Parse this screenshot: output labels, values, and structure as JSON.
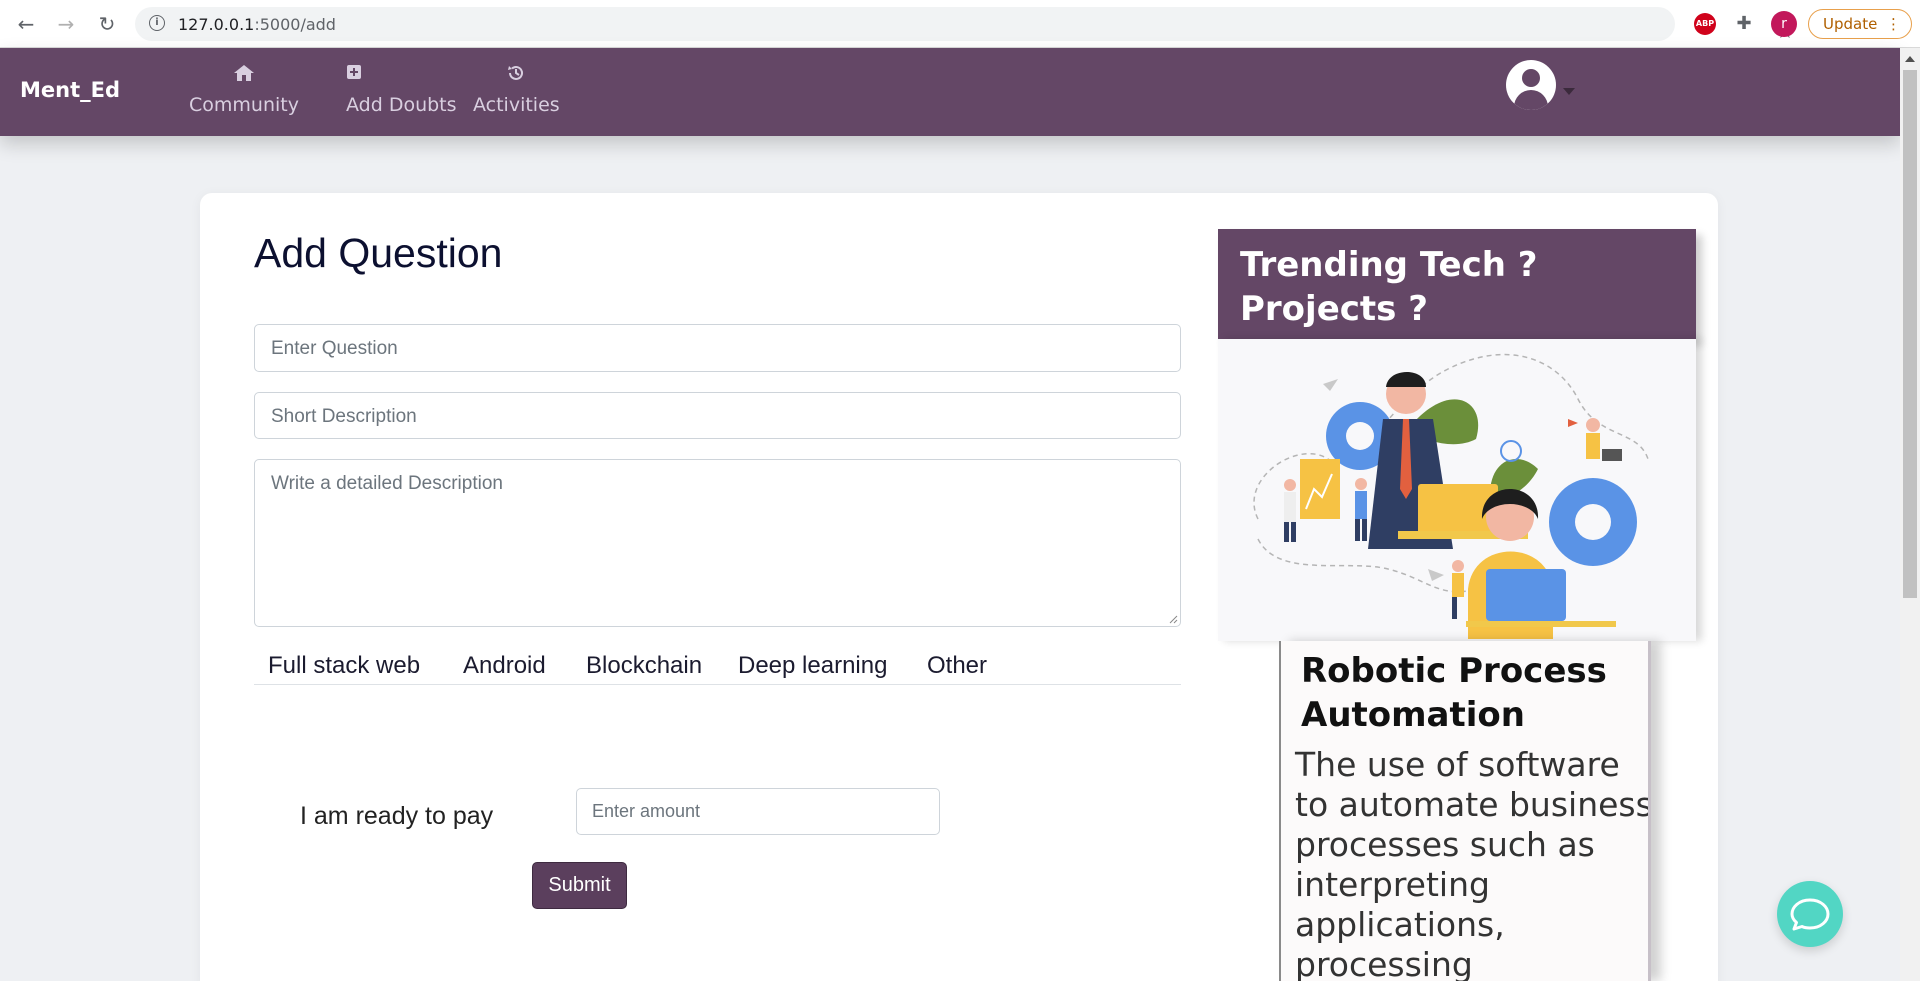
{
  "browser": {
    "url_host": "127.0.0.1",
    "url_path": ":5000/add",
    "profile_initial": "r",
    "update_label": "Update",
    "ext_abp_label": "ABP"
  },
  "nav": {
    "brand": "Ment_Ed",
    "items": [
      {
        "label": "Community",
        "icon": "home-icon"
      },
      {
        "label": "Add Doubts",
        "icon": "plus-square-icon"
      },
      {
        "label": "Activities",
        "icon": "history-icon"
      }
    ]
  },
  "form": {
    "title": "Add Question",
    "question_placeholder": "Enter Question",
    "short_desc_placeholder": "Short Description",
    "detail_placeholder": "Write a detailed Description",
    "categories": [
      "Full stack web",
      "Android",
      "Blockchain",
      "Deep learning",
      "Other"
    ],
    "pay_label": "I am ready to pay",
    "amount_placeholder": "Enter amount",
    "submit_label": "Submit"
  },
  "trending": {
    "title": "Trending Tech ? Projects ?",
    "card_title": "Robotic Process  Automation",
    "card_description": "The use of software to automate business processes such as interpreting applications, processing"
  },
  "colors": {
    "primary": "#644766",
    "chat": "#52d6c4"
  }
}
